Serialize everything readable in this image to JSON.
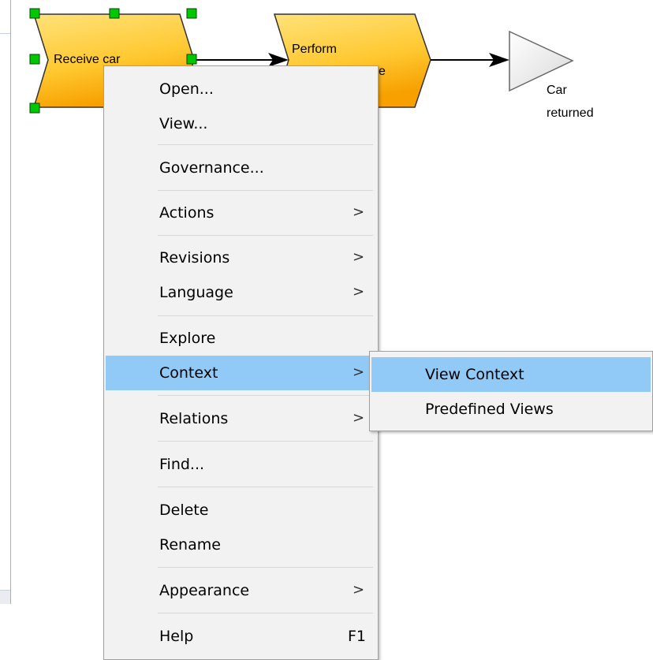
{
  "diagram": {
    "shapes": [
      {
        "id": "receive",
        "label": "Receive car"
      },
      {
        "id": "perform",
        "label": "Perform"
      },
      {
        "id": "perform_suffix",
        "label": "e"
      },
      {
        "id": "event",
        "label": "Car returned",
        "line1": "Car",
        "line2": "returned"
      }
    ],
    "colors": {
      "function_fill": "#ffc830",
      "handle": "#00c800",
      "event_fill": "#efefef"
    }
  },
  "context_menu": {
    "items": [
      {
        "label": "Open...",
        "has_submenu": false
      },
      {
        "label": "View...",
        "has_submenu": false
      },
      {
        "label": "Governance...",
        "has_submenu": false
      },
      {
        "label": "Actions",
        "has_submenu": true
      },
      {
        "label": "Revisions",
        "has_submenu": true
      },
      {
        "label": "Language",
        "has_submenu": true
      },
      {
        "label": "Explore",
        "has_submenu": false
      },
      {
        "label": "Context",
        "has_submenu": true,
        "highlighted": true
      },
      {
        "label": "Relations",
        "has_submenu": true
      },
      {
        "label": "Find...",
        "has_submenu": false
      },
      {
        "label": "Delete",
        "has_submenu": false
      },
      {
        "label": "Rename",
        "has_submenu": false
      },
      {
        "label": "Appearance",
        "has_submenu": true
      },
      {
        "label": "Help",
        "has_submenu": false,
        "shortcut": "F1"
      }
    ],
    "submenu_arrow": ">",
    "highlight_color": "#91c9f7"
  },
  "context_submenu": {
    "items": [
      {
        "label": "View Context",
        "highlighted": true
      },
      {
        "label": "Predefined Views",
        "highlighted": false
      }
    ]
  }
}
